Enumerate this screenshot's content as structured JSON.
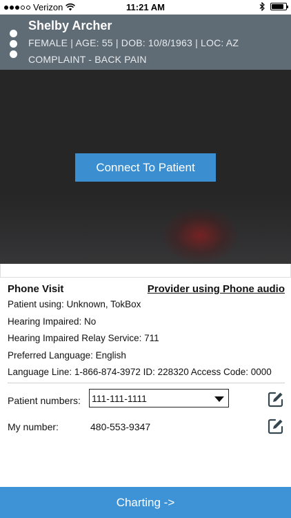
{
  "status_bar": {
    "carrier": "Verizon",
    "time": "11:21 AM",
    "signal_bars_filled": 3,
    "signal_bars_total": 5,
    "battery_level": 0.85
  },
  "patient": {
    "name": "Shelby Archer",
    "info": "FEMALE | AGE: 55 | DOB: 10/8/1963 | LOC: AZ",
    "complaint": "COMPLAINT - BACK PAIN"
  },
  "video": {
    "connect_label": "Connect To Patient"
  },
  "visit": {
    "title": "Phone Visit",
    "provider_link": "Provider using Phone audio",
    "lines": [
      "Patient using: Unknown, TokBox",
      "Hearing Impaired: No",
      "Hearing Impaired Relay Service: 711",
      "Preferred Language: English",
      "Language Line: 1-866-874-3972 ID: 228320 Access Code: 0000"
    ]
  },
  "numbers": {
    "patient_label": "Patient numbers:",
    "patient_selected": "111-111-1111",
    "my_label": "My number:",
    "my_value": "480-553-9347"
  },
  "footer": {
    "charting_label": "Charting ->"
  },
  "colors": {
    "header_bg": "#5f6b75",
    "accent": "#3d93d6",
    "video_bg": "#262626"
  }
}
